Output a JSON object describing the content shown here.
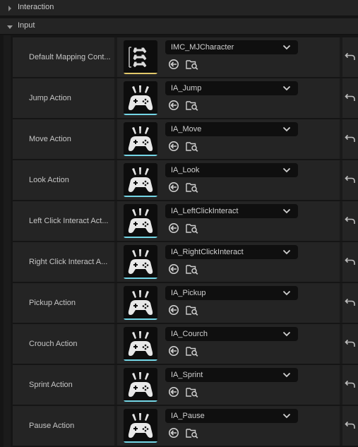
{
  "categories": {
    "interaction": "Interaction",
    "input": "Input"
  },
  "colors": {
    "context_strip": "#e2c96b",
    "action_strip": "#74d6e6"
  },
  "rows": [
    {
      "label": "Default Mapping Cont...",
      "value": "IMC_MJCharacter",
      "icon": "mapping-context-icon"
    },
    {
      "label": "Jump Action",
      "value": "IA_Jump",
      "icon": "input-action-icon"
    },
    {
      "label": "Move Action",
      "value": "IA_Move",
      "icon": "input-action-icon"
    },
    {
      "label": "Look Action",
      "value": "IA_Look",
      "icon": "input-action-icon"
    },
    {
      "label": "Left Click Interact Act...",
      "value": "IA_LeftClickInteract",
      "icon": "input-action-icon"
    },
    {
      "label": "Right Click Interact A...",
      "value": "IA_RightClickInteract",
      "icon": "input-action-icon"
    },
    {
      "label": "Pickup Action",
      "value": "IA_Pickup",
      "icon": "input-action-icon"
    },
    {
      "label": "Crouch Action",
      "value": "IA_Courch",
      "icon": "input-action-icon"
    },
    {
      "label": "Sprint Action",
      "value": "IA_Sprint",
      "icon": "input-action-icon"
    },
    {
      "label": "Pause Action",
      "value": "IA_Pause",
      "icon": "input-action-icon"
    }
  ]
}
